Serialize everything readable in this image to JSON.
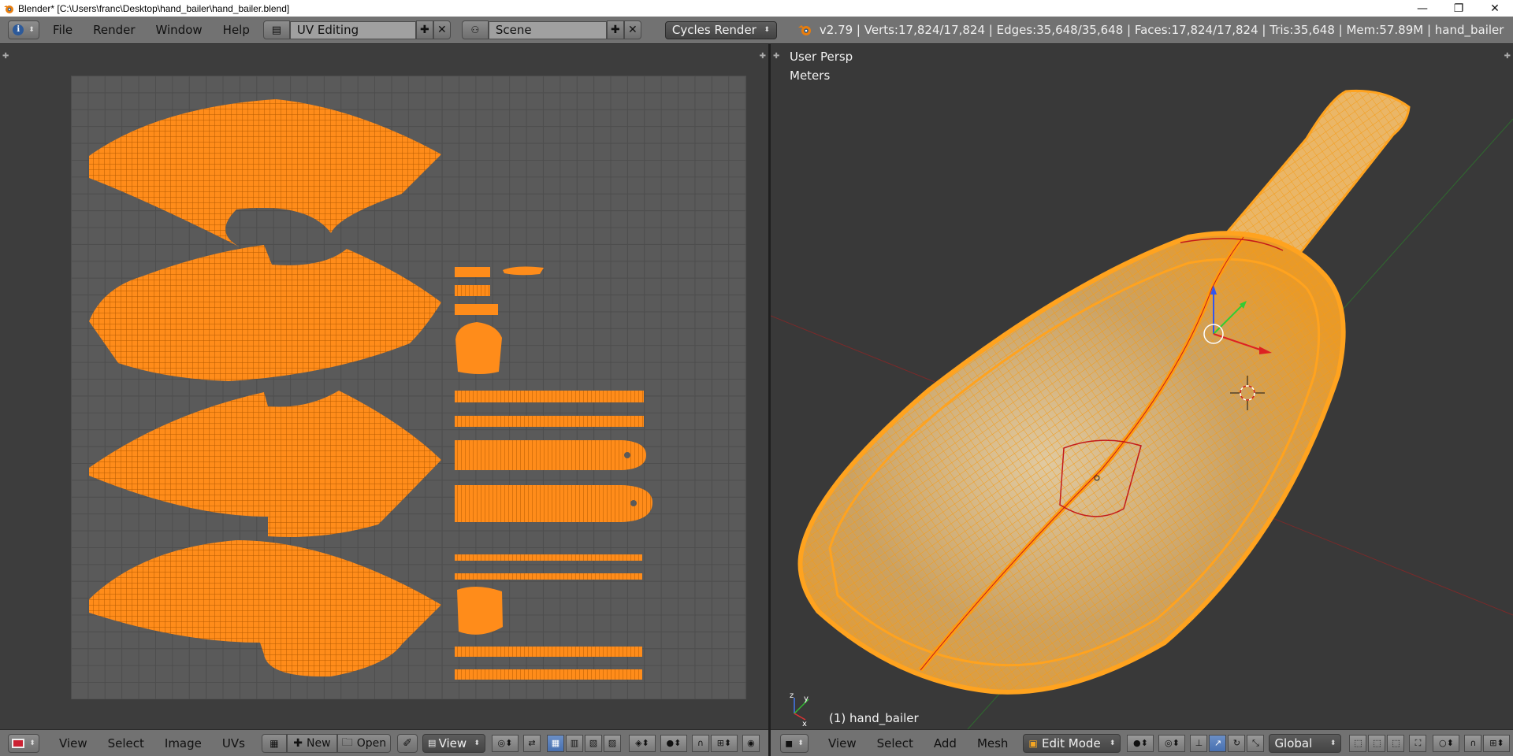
{
  "window": {
    "title": "Blender* [C:\\Users\\franc\\Desktop\\hand_bailer\\hand_bailer.blend]",
    "minimize": "—",
    "maximize": "❐",
    "close": "✕"
  },
  "info_header": {
    "menus": [
      "File",
      "Render",
      "Window",
      "Help"
    ],
    "screen_layout": "UV Editing",
    "scene": "Scene",
    "render_engine": "Cycles Render",
    "stats": "v2.79 | Verts:17,824/17,824 | Edges:35,648/35,648 | Faces:17,824/17,824 | Tris:35,648 | Mem:57.89M | hand_bailer"
  },
  "viewport": {
    "view_name": "User Persp",
    "units": "Meters",
    "object_label": "(1) hand_bailer"
  },
  "uv_header": {
    "menus": [
      "View",
      "Select",
      "Image",
      "UVs"
    ],
    "new_label": "New",
    "open_label": "Open",
    "view_label": "View"
  },
  "view3d_header": {
    "menus": [
      "View",
      "Select",
      "Add",
      "Mesh"
    ],
    "mode": "Edit Mode",
    "orientation": "Global"
  },
  "colors": {
    "uv_orange": "#ff8c1a",
    "mesh_orange": "#ffa31f",
    "seam_red": "#d11",
    "background": "#3d3d3d"
  }
}
